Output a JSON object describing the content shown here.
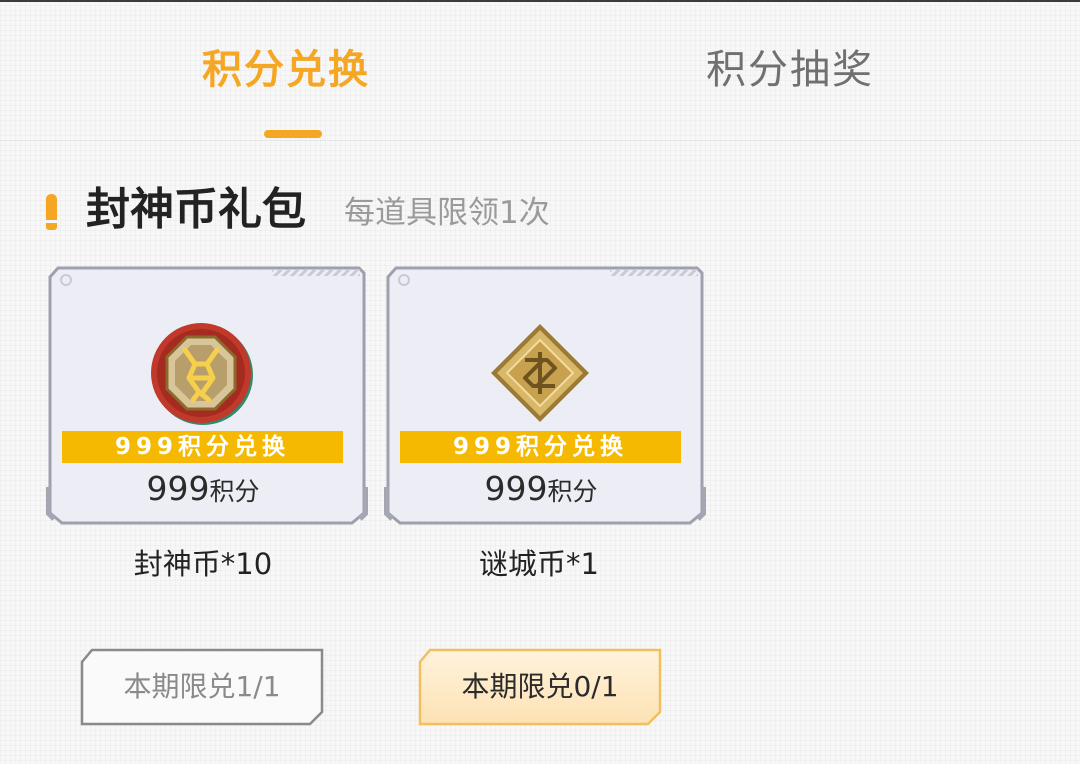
{
  "tabs": {
    "exchange_label": "积分兑换",
    "lottery_label": "积分抽奖",
    "active": "exchange"
  },
  "section": {
    "title": "封神币礼包",
    "subtitle": "每道具限领1次"
  },
  "items": [
    {
      "icon": "fengshen-coin-icon",
      "banner": "999积分兑换",
      "points_value": "999",
      "points_unit": "积分",
      "name": "封神币*10",
      "limit_label": "本期限兑1/1",
      "redeemed": 1,
      "limit": 1
    },
    {
      "icon": "micheng-coin-icon",
      "banner": "999积分兑换",
      "points_value": "999",
      "points_unit": "积分",
      "name": "谜城币*1",
      "limit_label": "本期限兑0/1",
      "redeemed": 0,
      "limit": 1
    }
  ],
  "colors": {
    "accent": "#f5a623",
    "banner": "#f4b900",
    "card_bg": "#edeef5",
    "card_border": "#9ea0ad",
    "disabled_border": "#8a8a8a",
    "active_button_fill": "#fde7c2",
    "active_button_border": "#f0c060"
  }
}
